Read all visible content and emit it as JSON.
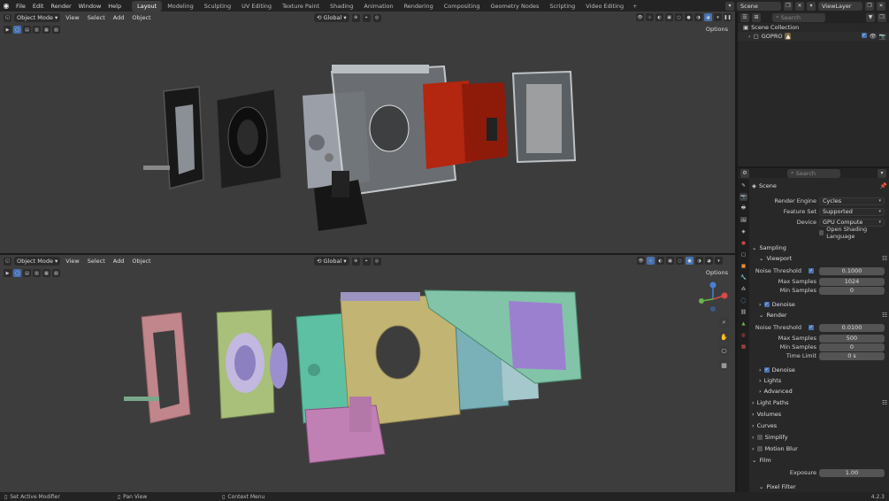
{
  "menu": [
    "File",
    "Edit",
    "Render",
    "Window",
    "Help"
  ],
  "workspaces": [
    {
      "label": "Layout",
      "active": true
    },
    {
      "label": "Modeling"
    },
    {
      "label": "Sculpting"
    },
    {
      "label": "UV Editing"
    },
    {
      "label": "Texture Paint"
    },
    {
      "label": "Shading"
    },
    {
      "label": "Animation"
    },
    {
      "label": "Rendering"
    },
    {
      "label": "Compositing"
    },
    {
      "label": "Geometry Nodes"
    },
    {
      "label": "Scripting"
    },
    {
      "label": "Video Editing"
    }
  ],
  "topright": {
    "scene": "Scene",
    "viewlayer": "ViewLayer"
  },
  "viewport": {
    "mode": "Object Mode",
    "menus": [
      "View",
      "Select",
      "Add",
      "Object"
    ],
    "orientation": "Global",
    "options": "Options"
  },
  "outliner": {
    "search_placeholder": "Search",
    "collection": "Scene Collection",
    "object": "GOPRO"
  },
  "properties": {
    "search_placeholder": "Search",
    "scene": "Scene",
    "render_engine": {
      "label": "Render Engine",
      "value": "Cycles"
    },
    "feature_set": {
      "label": "Feature Set",
      "value": "Supported"
    },
    "device": {
      "label": "Device",
      "value": "GPU Compute"
    },
    "osl": "Open Shading Language",
    "sampling": "Sampling",
    "viewport": "Viewport",
    "noise_threshold": "Noise Threshold",
    "max_samples": "Max Samples",
    "min_samples": "Min Samples",
    "time_limit": "Time Limit",
    "vp_noise": "0.1000",
    "vp_max": "1024",
    "vp_min": "0",
    "denoise": "Denoise",
    "render": "Render",
    "r_noise": "0.0100",
    "r_max": "500",
    "r_min": "0",
    "r_time": "0 s",
    "lights": "Lights",
    "advanced": "Advanced",
    "sections": [
      "Light Paths",
      "Volumes",
      "Curves",
      "Simplify",
      "Motion Blur",
      "Film"
    ],
    "exposure": {
      "label": "Exposure",
      "value": "1.00"
    },
    "pixel_filter": "Pixel Filter"
  },
  "status": {
    "left": "Set Active Modifier",
    "middle": "Pan View",
    "right": "Context Menu",
    "version": "4.2.3"
  },
  "colors": {
    "accent": "#4772b3",
    "bg": "#1d1d1d",
    "viewport": "#3d3d3d"
  }
}
